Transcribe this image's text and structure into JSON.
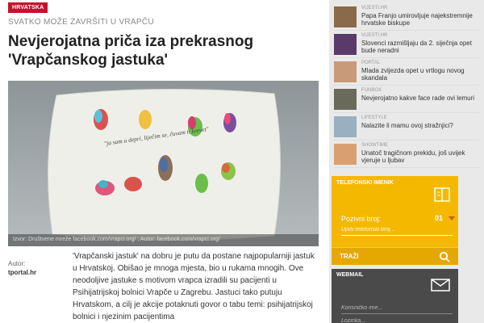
{
  "article": {
    "category_badge": "HRVATSKA",
    "kicker": "SVATKO MOŽE ZAVRŠITI U VRAPČU",
    "headline": "Nevjerojatna priča iza prekrasnog 'Vrapčanskog jastuka'",
    "pillow_text": "\"ja sam u depri, liječim se, čuvam ti krevet\"",
    "caption": "Izvor: Društvene mreže facebook.com/vrapci.org/ ; Autor: facebook.com/vrapci.org/",
    "author_label": "Autor:",
    "author_name": "tportal.hr",
    "body": "'Vrapčanski jastuk' na dobru je putu da postane najpopularniji jastuk u Hrvatskoj. Obišao je mnoga mjesta, bio u rukama mnogih. Ove neodoljive jastuke s motivom vrapca izradili su pacijenti u Psihijatrijskoj bolnici Vrapče u Zagrebu. Jastuci tako putuju Hrvatskom, a cilj je akcije potaknuti govor o tabu temi: psihijatrijskoj bolnici i njezinim pacijentima"
  },
  "sidebar": {
    "news": [
      {
        "category": "VIJESTI.HR",
        "title": "Papa Franjo umirovljuje najekstremnije hrvatske biskupe",
        "thumb_color": "#8a6a4a"
      },
      {
        "category": "VIJESTI.HR",
        "title": "Slovenci razmišljaju da 2. siječnja opet bude neradni",
        "thumb_color": "#5a3a6a"
      },
      {
        "category": "PORTAL",
        "title": "Mlada zvijezda opet u vrtlogu novog skandala",
        "thumb_color": "#c89a7a"
      },
      {
        "category": "FUNBOX",
        "title": "Nevjerojatno kakve face rade ovi lemuri",
        "thumb_color": "#6a6a5a"
      },
      {
        "category": "LIFESTYLE",
        "title": "Nalazite li mamu ovoj stražnjici?",
        "thumb_color": "#9ab0c0"
      },
      {
        "category": "SHOWTIME",
        "title": "Unatoč tragičnom prekidu, još uvijek vjeruje u ljubav",
        "thumb_color": "#d8a070"
      }
    ],
    "phonebook": {
      "title": "TELEFONSKI IMENIK",
      "phone_label": "Pozivni broj:",
      "prefix_value": "01",
      "placeholder": "Upiši telefonski broj...",
      "search_label": "TRAŽI"
    },
    "webmail": {
      "title": "WEBMAIL",
      "user_placeholder": "Korisničko ime...",
      "pass_placeholder": "Lozinka..."
    }
  },
  "colors": {
    "badge_red": "#c8102e",
    "phonebook_yellow": "#f5b800",
    "webmail_dark": "#4a4a4a"
  }
}
